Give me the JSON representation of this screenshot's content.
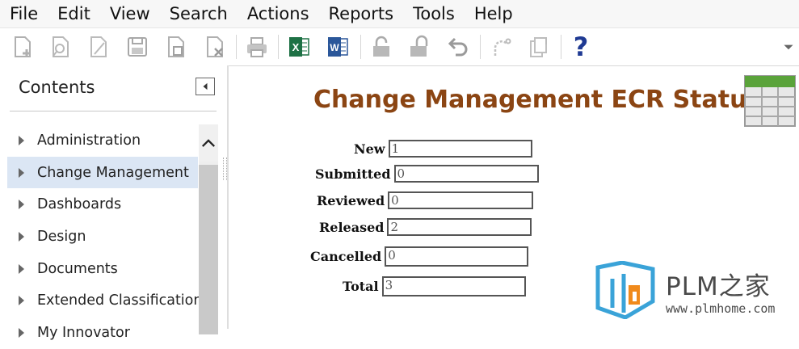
{
  "menu": [
    "File",
    "Edit",
    "View",
    "Search",
    "Actions",
    "Reports",
    "Tools",
    "Help"
  ],
  "toolbar": {
    "icons": [
      "new-icon",
      "search-icon",
      "edit-icon",
      "save-icon",
      "save-close-icon",
      "discard-icon",
      "print-icon",
      "excel-icon",
      "word-icon",
      "unlock-icon",
      "lock-icon",
      "undo-icon",
      "redo-icon",
      "export-icon",
      "help-icon"
    ],
    "help_symbol": "?",
    "excel_letter": "X",
    "word_letter": "W"
  },
  "sidebar": {
    "title": "Contents",
    "items": [
      {
        "label": "Administration",
        "active": false
      },
      {
        "label": "Change Management",
        "active": true
      },
      {
        "label": "Dashboards",
        "active": false
      },
      {
        "label": "Design",
        "active": false
      },
      {
        "label": "Documents",
        "active": false
      },
      {
        "label": "Extended Classification",
        "active": false
      },
      {
        "label": "My Innovator",
        "active": false
      }
    ]
  },
  "main": {
    "title": "Change Management ECR Status",
    "fields": [
      {
        "label": "New",
        "value": "1"
      },
      {
        "label": "Submitted",
        "value": "0"
      },
      {
        "label": "Reviewed",
        "value": "0"
      },
      {
        "label": "Released",
        "value": "2"
      },
      {
        "label": "Cancelled",
        "value": "0"
      },
      {
        "label": "Total",
        "value": "3"
      }
    ]
  },
  "watermark": {
    "brand": "PLM之家",
    "url": "www.plmhome.com"
  },
  "colors": {
    "title": "#8b4513",
    "active_nav": "#dbe6f4",
    "excel": "#1e7145",
    "word": "#2b579a",
    "help": "#1f3a93",
    "watermark_blue": "#3aa3d8",
    "watermark_orange": "#f08a1c"
  }
}
